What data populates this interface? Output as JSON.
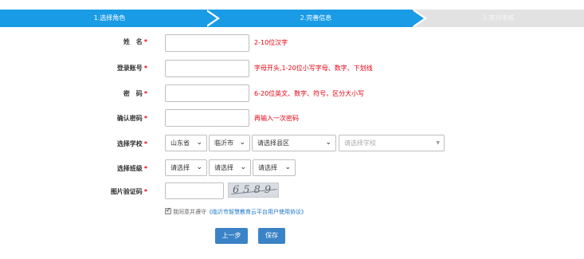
{
  "steps": [
    {
      "label": "1.选择角色"
    },
    {
      "label": "2.完善信息"
    },
    {
      "label": "3.等待审核"
    }
  ],
  "form": {
    "name": {
      "label": "姓　名",
      "value": "",
      "hint": "2-10位汉字"
    },
    "account": {
      "label": "登录账号",
      "value": "",
      "hint": "字母开头,1-20位小写字母、数字、下划线"
    },
    "password": {
      "label": "密　码",
      "value": "",
      "hint": "6-20位英文、数字、符号，区分大小写"
    },
    "confirm": {
      "label": "确认密码",
      "value": "",
      "hint": "再输入一次密码"
    },
    "school": {
      "label": "选择学校",
      "province": "山东省",
      "city": "临沂市",
      "district": "请选择县区",
      "school": "请选择学校"
    },
    "class": {
      "label": "选择班级",
      "grade": "请选择",
      "class": "请选择",
      "extra": "请选择"
    },
    "captcha": {
      "label": "图片验证码",
      "value": "",
      "image_text": "6589"
    },
    "required_mark": "*"
  },
  "agreement": {
    "prefix": "我同意并遵守",
    "link": "《临沂市智慧教育云平台用户使用协议》",
    "checked": true
  },
  "buttons": {
    "prev": "上一步",
    "save": "保存"
  },
  "colors": {
    "primary": "#1a9be6",
    "button": "#3a83c7",
    "error": "#e60012",
    "inactive_step": "#e2e2e2"
  }
}
